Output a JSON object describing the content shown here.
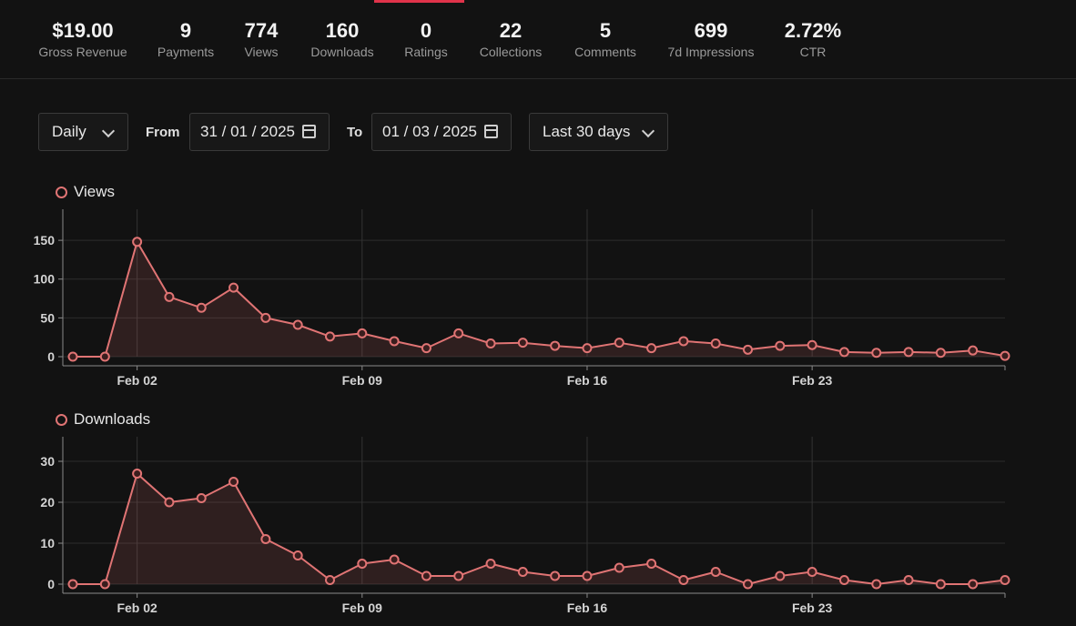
{
  "stats": [
    {
      "value": "$19.00",
      "label": "Gross Revenue"
    },
    {
      "value": "9",
      "label": "Payments"
    },
    {
      "value": "774",
      "label": "Views"
    },
    {
      "value": "160",
      "label": "Downloads"
    },
    {
      "value": "0",
      "label": "Ratings"
    },
    {
      "value": "22",
      "label": "Collections"
    },
    {
      "value": "5",
      "label": "Comments"
    },
    {
      "value": "699",
      "label": "7d Impressions"
    },
    {
      "value": "2.72%",
      "label": "CTR"
    }
  ],
  "controls": {
    "interval": "Daily",
    "from_label": "From",
    "from_date": "31 / 01 / 2025",
    "to_label": "To",
    "to_date": "01 / 03 / 2025",
    "range": "Last 30 days"
  },
  "colors": {
    "accent": "#e0334a",
    "series": "#e07474",
    "background": "#121212"
  },
  "chart_data": [
    {
      "type": "area",
      "legend": "Views",
      "x": [
        "Jan 31",
        "Feb 01",
        "Feb 02",
        "Feb 03",
        "Feb 04",
        "Feb 05",
        "Feb 06",
        "Feb 07",
        "Feb 08",
        "Feb 09",
        "Feb 10",
        "Feb 11",
        "Feb 12",
        "Feb 13",
        "Feb 14",
        "Feb 15",
        "Feb 16",
        "Feb 17",
        "Feb 18",
        "Feb 19",
        "Feb 20",
        "Feb 21",
        "Feb 22",
        "Feb 23",
        "Feb 24",
        "Feb 25",
        "Feb 26",
        "Feb 27",
        "Feb 28",
        "Mar 01"
      ],
      "series": [
        {
          "name": "Views",
          "values": [
            0,
            0,
            148,
            77,
            63,
            89,
            50,
            41,
            26,
            30,
            20,
            11,
            30,
            17,
            18,
            14,
            11,
            18,
            11,
            20,
            17,
            9,
            14,
            15,
            6,
            5,
            6,
            5,
            8,
            1
          ]
        }
      ],
      "ylim": [
        0,
        190
      ],
      "yticks": [
        "0",
        "50",
        "100",
        "150"
      ],
      "xticks": [
        "Feb 02",
        "Feb 09",
        "Feb 16",
        "Feb 23"
      ],
      "grid": true
    },
    {
      "type": "area",
      "legend": "Downloads",
      "x": [
        "Jan 31",
        "Feb 01",
        "Feb 02",
        "Feb 03",
        "Feb 04",
        "Feb 05",
        "Feb 06",
        "Feb 07",
        "Feb 08",
        "Feb 09",
        "Feb 10",
        "Feb 11",
        "Feb 12",
        "Feb 13",
        "Feb 14",
        "Feb 15",
        "Feb 16",
        "Feb 17",
        "Feb 18",
        "Feb 19",
        "Feb 20",
        "Feb 21",
        "Feb 22",
        "Feb 23",
        "Feb 24",
        "Feb 25",
        "Feb 26",
        "Feb 27",
        "Feb 28",
        "Mar 01"
      ],
      "series": [
        {
          "name": "Downloads",
          "values": [
            0,
            0,
            27,
            20,
            21,
            25,
            11,
            7,
            1,
            5,
            6,
            2,
            2,
            5,
            3,
            2,
            2,
            4,
            5,
            1,
            3,
            0,
            2,
            3,
            1,
            0,
            1,
            0,
            0,
            1
          ]
        }
      ],
      "ylim": [
        0,
        36
      ],
      "yticks": [
        "0",
        "10",
        "20",
        "30"
      ],
      "xticks": [
        "Feb 02",
        "Feb 09",
        "Feb 16",
        "Feb 23"
      ],
      "grid": true
    }
  ]
}
